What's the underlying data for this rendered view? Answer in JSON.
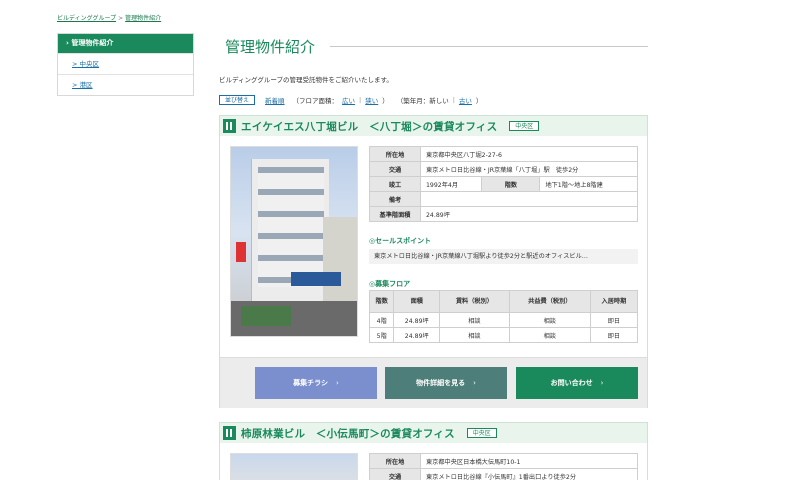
{
  "breadcrumb": {
    "home": "ビルディンググループ",
    "separator": ">",
    "current": "管理物件紹介"
  },
  "sidebar": {
    "heading": "› 管理物件紹介",
    "items": [
      {
        "label": "> 中央区"
      },
      {
        "label": "> 港区"
      }
    ]
  },
  "page": {
    "title": "管理物件紹介",
    "intro": "ビルディンググループの管理受託物件をご紹介いたします。"
  },
  "sort": {
    "button": "並び替え",
    "newest": "新着順",
    "floor_label": "（フロア面積：",
    "floor_wide": "広い",
    "floor_sep": "|",
    "floor_narrow": "狭い",
    "floor_close": "）",
    "built_label": "（築年月：新しい",
    "built_sep": "|",
    "built_old": "古い",
    "built_close": "）"
  },
  "properties": [
    {
      "title": "エイケイエス八丁堀ビル　＜八丁堀＞の賃貸オフィス",
      "area": "中央区",
      "info": {
        "address_label": "所在地",
        "address": "東京都中央区八丁堀2-27-6",
        "access_label": "交通",
        "access": "東京メトロ日比谷線・JR京葉線「八丁堀」駅　徒歩2分",
        "built_label": "竣工",
        "built": "1992年4月",
        "floors_label": "階数",
        "floors": "地下1階～地上8階建",
        "note_label": "備考",
        "note": "",
        "std_area_label": "基準階面積",
        "std_area": "24.89坪"
      },
      "sales_point_title": "セールスポイント",
      "sales_point": "東京メトロ日比谷線・JR京葉線八丁堀駅より徒歩2分と駅近のオフィスビル…",
      "floor_title": "募集フロア",
      "floor_headers": {
        "floor": "階数",
        "area": "面積",
        "rent": "賃料（税別）",
        "fee": "共益費（税別）",
        "move_in": "入居時期"
      },
      "floor_rows": [
        {
          "floor": "4階",
          "area": "24.89坪",
          "rent": "相談",
          "fee": "相談",
          "move_in": "即日"
        },
        {
          "floor": "5階",
          "area": "24.89坪",
          "rent": "相談",
          "fee": "相談",
          "move_in": "即日"
        }
      ],
      "buttons": {
        "flyer": "募集チラシ",
        "detail": "物件詳細を見る",
        "contact": "お問い合わせ",
        "arrow": "›"
      }
    },
    {
      "title": "柿原林業ビル　＜小伝馬町＞の賃貸オフィス",
      "area": "中央区",
      "info": {
        "address_label": "所在地",
        "address": "東京都中央区日本橋大伝馬町10-1",
        "access_label": "交通",
        "access": "東京メトロ日比谷線『小伝馬町』1番出口より徒歩2分"
      }
    }
  ],
  "colors": {
    "brand_green": "#1a8a5c",
    "link_blue": "#1a6fa8",
    "flyer_btn": "#7b8fcf",
    "detail_btn": "#4e7e79",
    "contact_btn": "#1a8a5c"
  }
}
